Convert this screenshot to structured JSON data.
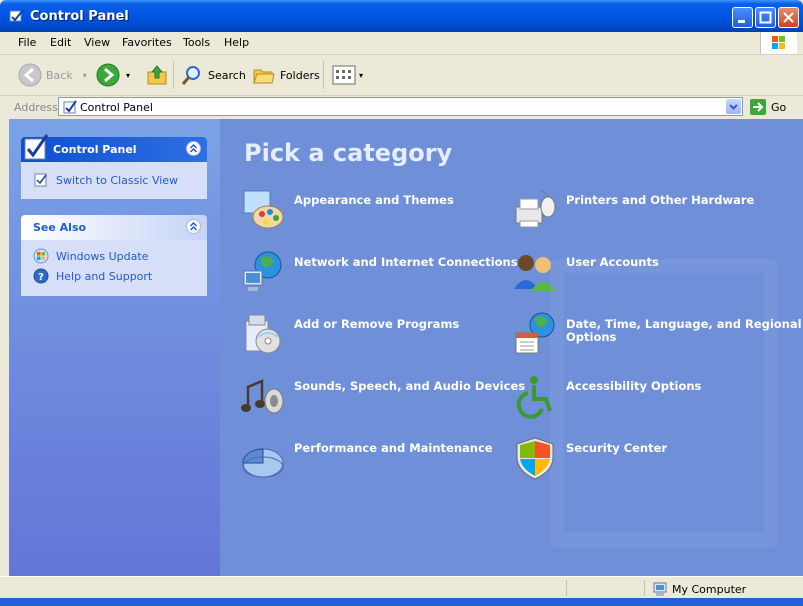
{
  "window": {
    "title": "Control Panel"
  },
  "menu": {
    "items": [
      "File",
      "Edit",
      "View",
      "Favorites",
      "Tools",
      "Help"
    ]
  },
  "toolbar": {
    "back": "Back",
    "search": "Search",
    "folders": "Folders"
  },
  "address": {
    "label": "Address",
    "value": "Control Panel",
    "go": "Go"
  },
  "left": {
    "control_panel": {
      "title": "Control Panel",
      "links": [
        "Switch to Classic View"
      ]
    },
    "see_also": {
      "title": "See Also",
      "links": [
        "Windows Update",
        "Help and Support"
      ]
    }
  },
  "main": {
    "heading": "Pick a category",
    "categories": [
      "Appearance and Themes",
      "Printers and Other Hardware",
      "Network and Internet Connections",
      "User Accounts",
      "Add or Remove Programs",
      "Date, Time, Language, and Regional Options",
      "Sounds, Speech, and Audio Devices",
      "Accessibility Options",
      "Performance and Maintenance",
      "Security Center"
    ]
  },
  "status": {
    "location": "My Computer"
  },
  "colors": {
    "titlebar": "#0055e5",
    "left_pane": "#7ba2e7",
    "main_pane": "#6f8fd8",
    "link": "#215dc6"
  },
  "icons": [
    "control-panel-icon",
    "back-icon",
    "forward-icon",
    "up-folder-icon",
    "search-icon",
    "folders-icon",
    "views-icon",
    "go-icon",
    "my-computer-icon"
  ]
}
